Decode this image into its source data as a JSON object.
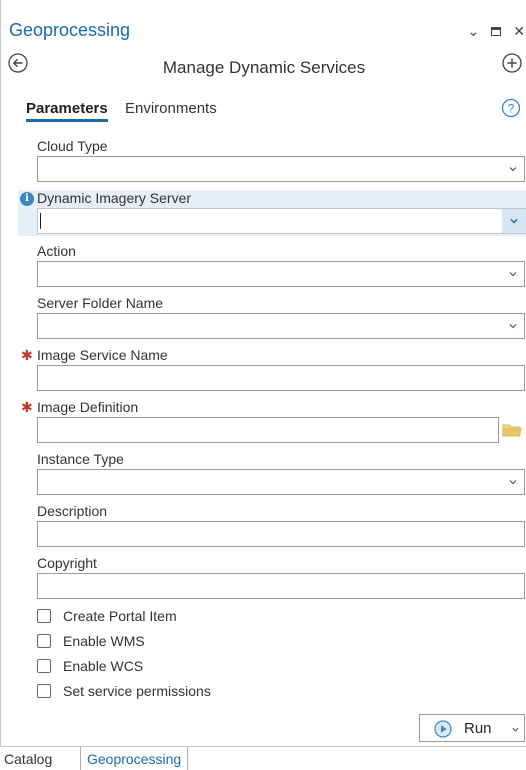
{
  "pane": {
    "title": "Geoprocessing",
    "controls": {
      "pin": "⌄",
      "maximize": "□",
      "close": "✕"
    }
  },
  "tool": {
    "title": "Manage Dynamic Services"
  },
  "tabs": [
    {
      "label": "Parameters",
      "active": true
    },
    {
      "label": "Environments",
      "active": false
    }
  ],
  "params": [
    {
      "label": "Cloud Type",
      "kind": "dropdown",
      "value": "",
      "required": false
    },
    {
      "label": "Dynamic Imagery Server",
      "kind": "dropdown",
      "value": "",
      "required": false,
      "info": true,
      "focused": true
    },
    {
      "label": "Action",
      "kind": "dropdown",
      "value": "",
      "required": false
    },
    {
      "label": "Server Folder Name",
      "kind": "dropdown",
      "value": "",
      "required": false
    },
    {
      "label": "Image Service Name",
      "kind": "text",
      "value": "",
      "required": true
    },
    {
      "label": "Image Definition",
      "kind": "file",
      "value": "",
      "required": true
    },
    {
      "label": "Instance Type",
      "kind": "dropdown",
      "value": "",
      "required": false
    },
    {
      "label": "Description",
      "kind": "text",
      "value": "",
      "required": false
    },
    {
      "label": "Copyright",
      "kind": "text",
      "value": "",
      "required": false
    }
  ],
  "checkboxes": [
    {
      "label": "Create Portal Item",
      "checked": false
    },
    {
      "label": "Enable WMS",
      "checked": false
    },
    {
      "label": "Enable WCS",
      "checked": false
    },
    {
      "label": "Set service permissions",
      "checked": false
    }
  ],
  "run": {
    "label": "Run"
  },
  "bottom_tabs": [
    {
      "label": "Catalog",
      "active": false
    },
    {
      "label": "Geoprocessing",
      "active": true
    }
  ],
  "colors": {
    "accent": "#1a6ab0",
    "required": "#c0392b",
    "info": "#3a86c8",
    "folder": "#e8c86a"
  },
  "icons": {
    "back": "back-arrow-icon",
    "add": "plus-circle-icon",
    "help": "help-icon",
    "info": "info-icon",
    "folder": "folder-icon",
    "run": "play-icon",
    "dropdown": "chevron-down-icon"
  }
}
